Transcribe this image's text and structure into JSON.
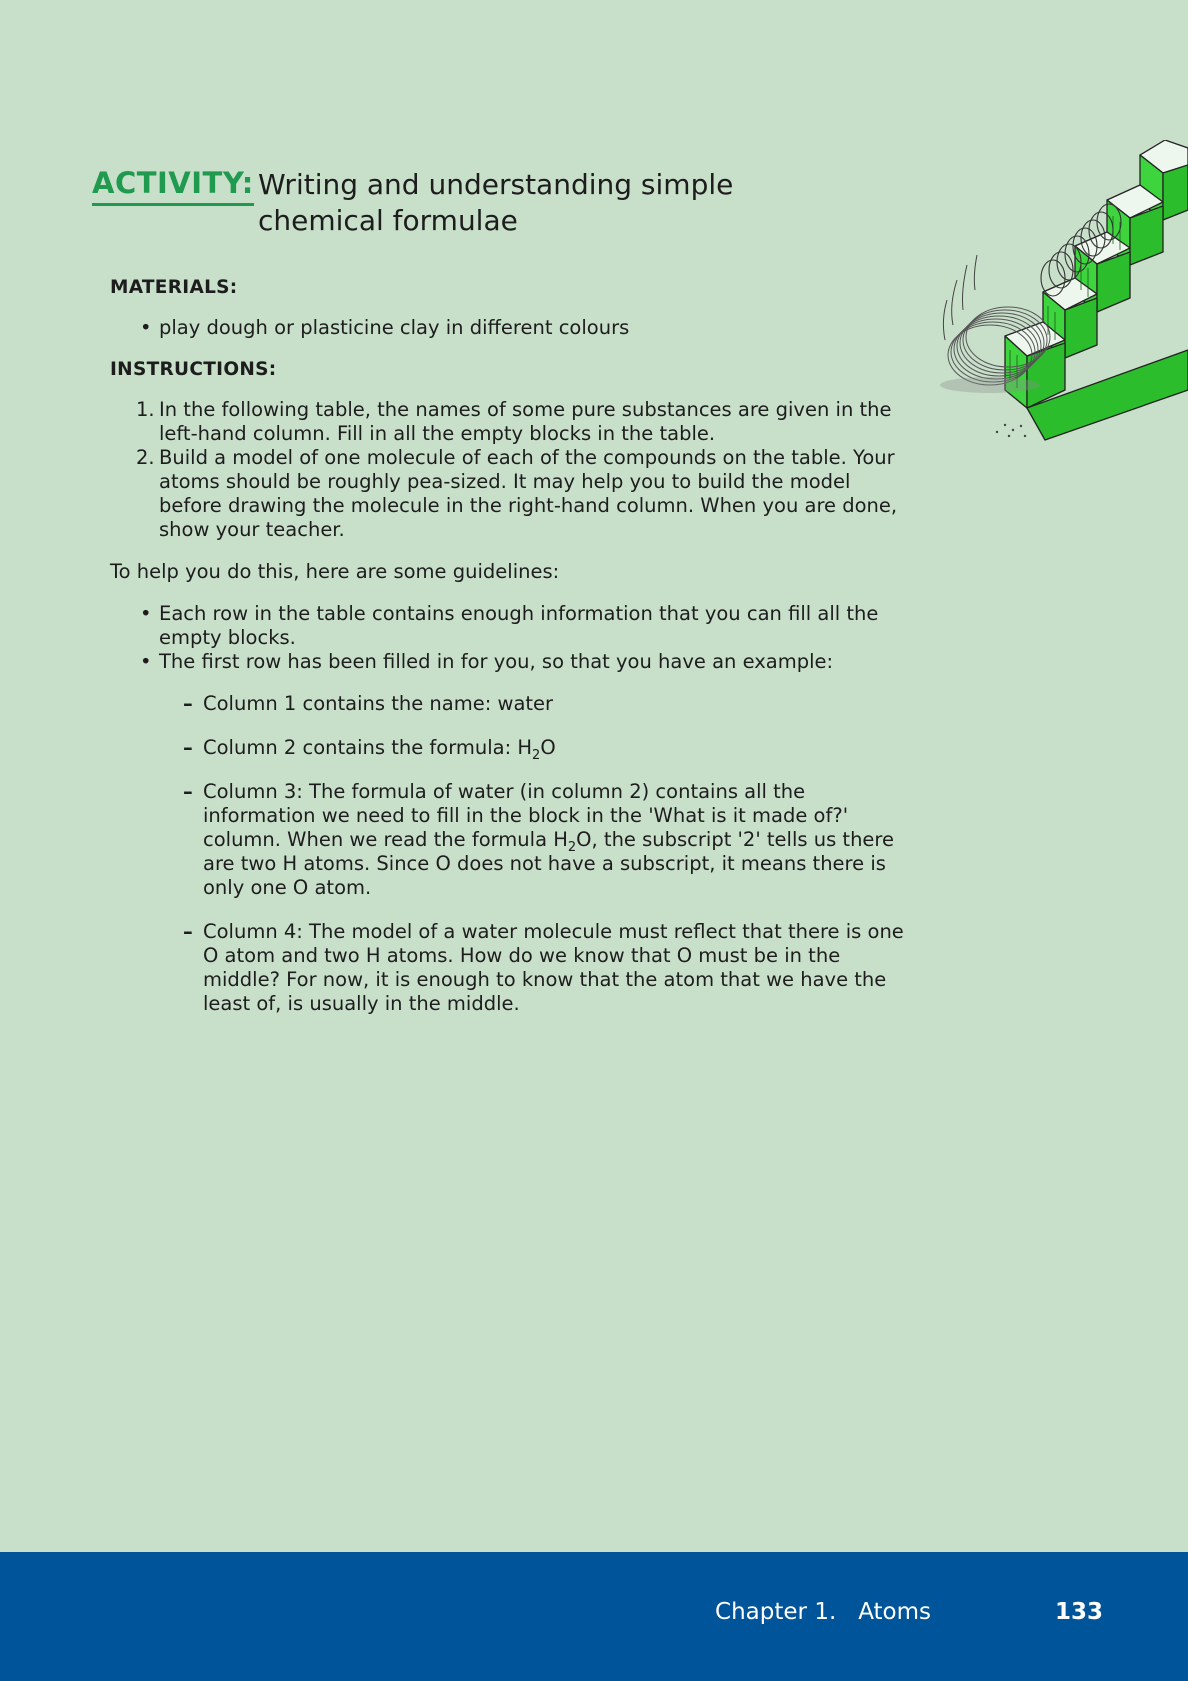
{
  "activity": {
    "label": "ACTIVITY:",
    "title": "Writing and understanding simple chemical formulae"
  },
  "materials": {
    "heading": "MATERIALS:",
    "items": [
      "play dough or plasticine clay in different colours"
    ]
  },
  "instructions": {
    "heading": "INSTRUCTIONS:",
    "steps": [
      {
        "number": "1.",
        "text": "In the following table, the names of some pure substances are given in the left-hand column. Fill in all the empty blocks in the table."
      },
      {
        "number": "2.",
        "text": "Build a model of one molecule of each of the compounds on the table. Your atoms should be roughly pea-sized. It may help you to build the model before drawing the molecule in the right-hand column. When you are done, show your teacher."
      }
    ]
  },
  "guidelines": {
    "intro": "To help you do this, here are some guidelines:",
    "bullets": [
      "Each row in the table contains enough information that you can fill all the empty blocks.",
      "The first row has been filled in for you, so that you have an example:"
    ],
    "columns": {
      "col1": "Column 1 contains the name: water",
      "col2_before": "Column 2 contains the formula: H",
      "col2_sub": "2",
      "col2_after": "O",
      "col3_a": "Column 3: The formula of water (in column 2) contains all the information we need to fill in the block in the 'What is it made of?' column. When we read the formula H",
      "col3_sub": "2",
      "col3_b": "O, the subscript '2' tells us there are two H atoms. Since O does not have a subscript, it means there is only one O atom.",
      "col4": "Column 4: The model of a water molecule must reflect that there is one O atom and two H atoms. How do we know that O must be in the middle? For now, it is enough to know that the atom that we have the least of, is usually in the middle."
    }
  },
  "footer": {
    "chapter": "Chapter 1.   Atoms",
    "page_number": "133"
  },
  "colors": {
    "page_background": "#c8dfca",
    "activity_green": "#1f9a4f",
    "footer_blue": "#00549a"
  }
}
